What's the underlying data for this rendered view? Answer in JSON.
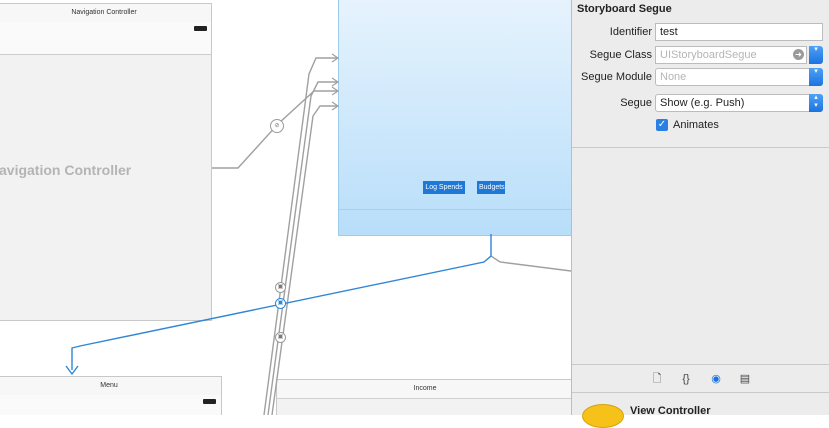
{
  "canvas": {
    "nav_scene": {
      "title": "Navigation Controller",
      "label": "avigation Controller"
    },
    "view_scene": {
      "buttons": [
        "Log Spends",
        "Budgets"
      ]
    },
    "menu_scene": {
      "title": "Menu"
    },
    "income_scene": {
      "title": "Income"
    }
  },
  "inspector": {
    "section_title": "Storyboard Segue",
    "identifier": {
      "label": "Identifier",
      "value": "test"
    },
    "segue_class": {
      "label": "Segue Class",
      "placeholder": "UIStoryboardSegue"
    },
    "segue_module": {
      "label": "Segue Module",
      "placeholder": "None"
    },
    "segue": {
      "label": "Segue",
      "value": "Show (e.g. Push)"
    },
    "animates": {
      "label": "Animates",
      "checked": true
    },
    "tabs": [
      "file-icon",
      "braces-icon",
      "identity-circle-icon",
      "library-icon"
    ],
    "library_item": {
      "text": "View Controller"
    }
  },
  "colors": {
    "selection_blue": "#2f86d6",
    "accent": "#1a73e0"
  }
}
